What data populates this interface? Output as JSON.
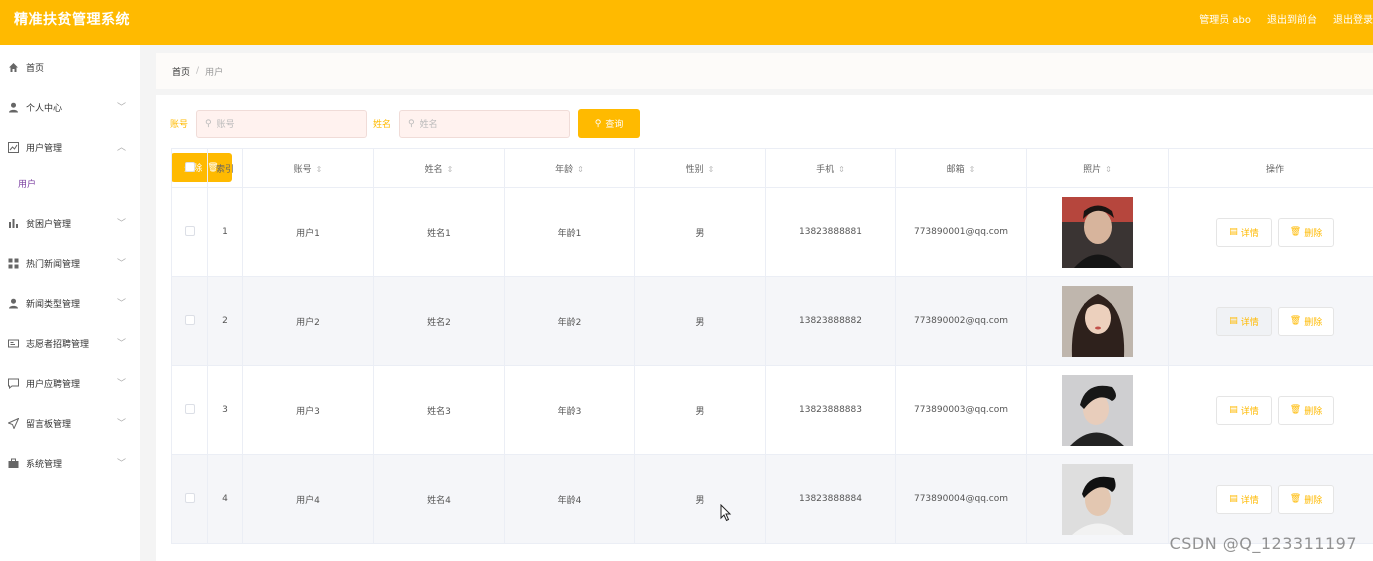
{
  "header": {
    "title": "精准扶贫管理系统",
    "admin": "管理员 abo",
    "exit_front": "退出到前台",
    "logout": "退出登录"
  },
  "sidebar": {
    "items": [
      {
        "label": "首页",
        "icon": "home-icon"
      },
      {
        "label": "个人中心",
        "icon": "user-icon"
      },
      {
        "label": "用户管理",
        "icon": "chart-icon"
      },
      {
        "label": "贫困户管理",
        "icon": "bar-chart-icon"
      },
      {
        "label": "热门新闻管理",
        "icon": "grid-icon"
      },
      {
        "label": "新闻类型管理",
        "icon": "user-icon"
      },
      {
        "label": "志愿者招聘管理",
        "icon": "id-card-icon"
      },
      {
        "label": "用户应聘管理",
        "icon": "message-icon"
      },
      {
        "label": "留言板管理",
        "icon": "send-icon"
      },
      {
        "label": "系统管理",
        "icon": "briefcase-icon"
      }
    ],
    "sub_item": "用户"
  },
  "breadcrumb": {
    "home": "首页",
    "current": "用户"
  },
  "search": {
    "account_label": "账号",
    "account_placeholder": "账号",
    "name_label": "姓名",
    "name_placeholder": "姓名",
    "query_label": "查询"
  },
  "delete_button": "删除",
  "table": {
    "headers": [
      "索引",
      "账号",
      "姓名",
      "年龄",
      "性别",
      "手机",
      "邮箱",
      "照片",
      "操作"
    ],
    "detail_label": "详情",
    "delete_label": "删除",
    "rows": [
      {
        "index": "1",
        "account": "用户1",
        "name": "姓名1",
        "age": "年龄1",
        "gender": "男",
        "phone": "13823888881",
        "email": "773890001@qq.com"
      },
      {
        "index": "2",
        "account": "用户2",
        "name": "姓名2",
        "age": "年龄2",
        "gender": "男",
        "phone": "13823888882",
        "email": "773890002@qq.com"
      },
      {
        "index": "3",
        "account": "用户3",
        "name": "姓名3",
        "age": "年龄3",
        "gender": "男",
        "phone": "13823888883",
        "email": "773890003@qq.com"
      },
      {
        "index": "4",
        "account": "用户4",
        "name": "姓名4",
        "age": "年龄4",
        "gender": "男",
        "phone": "13823888884",
        "email": "773890004@qq.com"
      }
    ]
  },
  "watermark": "CSDN @Q_123311197",
  "colors": {
    "accent": "#ffba00",
    "sidebar_active_sub": "#7b3fa0"
  }
}
